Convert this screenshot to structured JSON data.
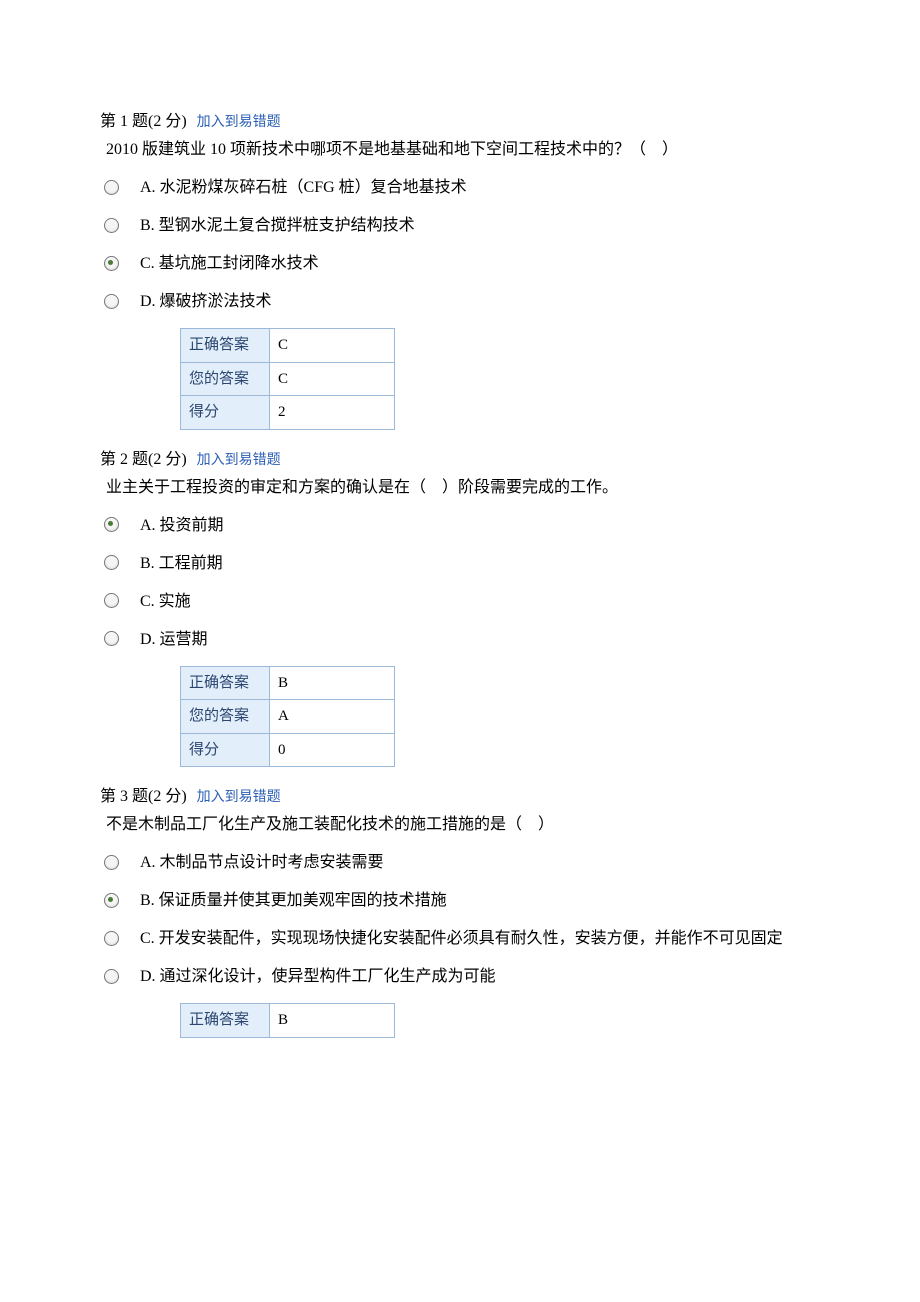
{
  "common": {
    "add_link_label": "加入到易错题",
    "correct_answer_label": "正确答案",
    "your_answer_label": "您的答案",
    "score_label": "得分"
  },
  "questions": [
    {
      "header": "第 1 题(2 分)",
      "text": " 2010 版建筑业 10 项新技术中哪项不是地基基础和地下空间工程技术中的？（　）",
      "options": [
        {
          "label": "A. 水泥粉煤灰碎石桩（CFG 桩）复合地基技术",
          "selected": false
        },
        {
          "label": "B. 型钢水泥土复合搅拌桩支护结构技术",
          "selected": false
        },
        {
          "label": "C. 基坑施工封闭降水技术",
          "selected": true
        },
        {
          "label": "D. 爆破挤淤法技术",
          "selected": false
        }
      ],
      "answer_rows": [
        {
          "label_key": "correct_answer_label",
          "value": "C"
        },
        {
          "label_key": "your_answer_label",
          "value": "C"
        },
        {
          "label_key": "score_label",
          "value": "2"
        }
      ]
    },
    {
      "header": " 第 2 题(2 分)",
      "text": " 业主关于工程投资的审定和方案的确认是在（　）阶段需要完成的工作。",
      "options": [
        {
          "label": "A. 投资前期",
          "selected": true
        },
        {
          "label": "B. 工程前期",
          "selected": false
        },
        {
          "label": "C. 实施",
          "selected": false
        },
        {
          "label": "D. 运营期",
          "selected": false
        }
      ],
      "answer_rows": [
        {
          "label_key": "correct_answer_label",
          "value": "B"
        },
        {
          "label_key": "your_answer_label",
          "value": "A"
        },
        {
          "label_key": "score_label",
          "value": "0"
        }
      ]
    },
    {
      "header": " 第 3 题(2 分)",
      "text": " 不是木制品工厂化生产及施工装配化技术的施工措施的是（　）",
      "options": [
        {
          "label": "A. 木制品节点设计时考虑安装需要",
          "selected": false
        },
        {
          "label": "B. 保证质量并使其更加美观牢固的技术措施",
          "selected": true
        },
        {
          "label": "C. 开发安装配件，实现现场快捷化安装配件必须具有耐久性，安装方便，并能作不可见固定",
          "selected": false
        },
        {
          "label": "D. 通过深化设计，使异型构件工厂化生产成为可能",
          "selected": false
        }
      ],
      "answer_rows": [
        {
          "label_key": "correct_answer_label",
          "value": "B"
        }
      ]
    }
  ]
}
